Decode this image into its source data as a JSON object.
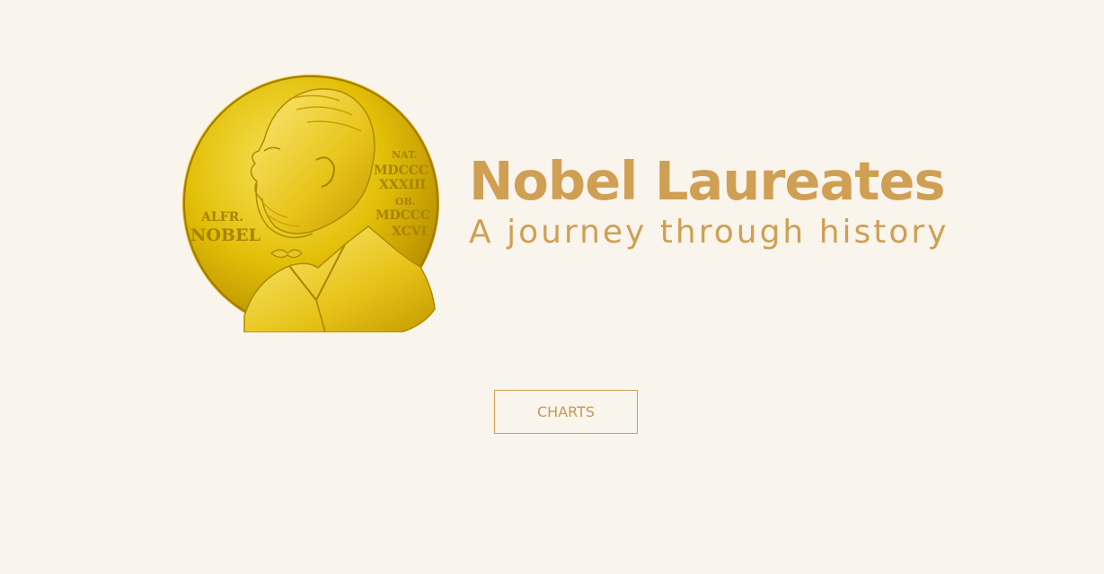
{
  "hero": {
    "title": "Nobel Laureates",
    "subtitle": "A journey through history",
    "medal": {
      "icon": "nobel-medal-icon",
      "inscription_left_1": "ALFR.",
      "inscription_left_2": "NOBEL",
      "inscription_right_1": "NAT.",
      "inscription_right_2": "MDCCC",
      "inscription_right_3": "XXXIII",
      "inscription_right_4": "OB.",
      "inscription_right_5": "MDCCC",
      "inscription_right_6": "XCVI"
    }
  },
  "nav": {
    "charts_label": "CHARTS"
  },
  "colors": {
    "background": "#f9f4ec",
    "accent": "#cfa053",
    "gold": "#e6c000"
  }
}
